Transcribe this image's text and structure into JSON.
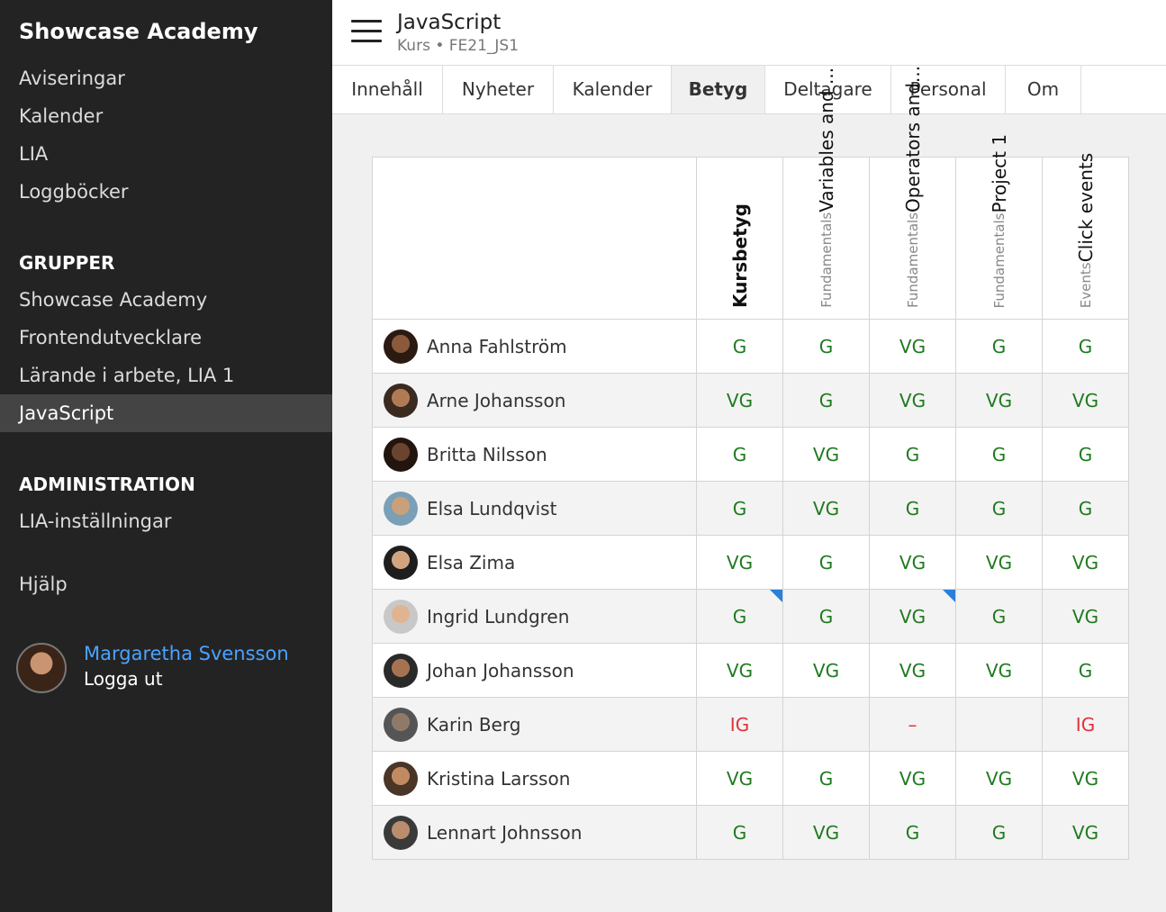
{
  "sidebar": {
    "brand": "Showcase Academy",
    "top_items": [
      "Aviseringar",
      "Kalender",
      "LIA",
      "Loggböcker"
    ],
    "groups_heading": "GRUPPER",
    "groups": [
      "Showcase Academy",
      "Frontendutvecklare",
      "Lärande i arbete, LIA 1",
      "JavaScript"
    ],
    "active_group": "JavaScript",
    "admin_heading": "ADMINISTRATION",
    "admin_items": [
      "LIA-inställningar"
    ],
    "help": "Hjälp",
    "user_name": "Margaretha Svensson",
    "logout": "Logga ut"
  },
  "header": {
    "title": "JavaScript",
    "subtitle": "Kurs • FE21_JS1"
  },
  "tabs": [
    "Innehåll",
    "Nyheter",
    "Kalender",
    "Betyg",
    "Deltagare",
    "Personal",
    "Om"
  ],
  "active_tab": "Betyg",
  "grades": {
    "columns": [
      {
        "category": "",
        "name": "Kursbetyg"
      },
      {
        "category": "Fundamentals",
        "name": "Variables and ..."
      },
      {
        "category": "Fundamentals",
        "name": "Operators and..."
      },
      {
        "category": "Fundamentals",
        "name": "Project 1"
      },
      {
        "category": "Events",
        "name": "Click events"
      }
    ],
    "students": [
      {
        "name": "Anna Fahlström",
        "grades": [
          "G",
          "G",
          "VG",
          "G",
          "G"
        ]
      },
      {
        "name": "Arne Johansson",
        "grades": [
          "VG",
          "G",
          "VG",
          "VG",
          "VG"
        ]
      },
      {
        "name": "Britta Nilsson",
        "grades": [
          "G",
          "VG",
          "G",
          "G",
          "G"
        ]
      },
      {
        "name": "Elsa Lundqvist",
        "grades": [
          "G",
          "VG",
          "G",
          "G",
          "G"
        ]
      },
      {
        "name": "Elsa Zima",
        "grades": [
          "VG",
          "G",
          "VG",
          "VG",
          "VG"
        ]
      },
      {
        "name": "Ingrid Lundgren",
        "grades": [
          "G",
          "G",
          "VG",
          "G",
          "VG"
        ]
      },
      {
        "name": "Johan Johansson",
        "grades": [
          "VG",
          "VG",
          "VG",
          "VG",
          "G"
        ]
      },
      {
        "name": "Karin Berg",
        "grades": [
          "IG",
          "",
          "–",
          "",
          "IG"
        ]
      },
      {
        "name": "Kristina Larsson",
        "grades": [
          "VG",
          "G",
          "VG",
          "VG",
          "VG"
        ]
      },
      {
        "name": "Lennart Johnsson",
        "grades": [
          "G",
          "VG",
          "G",
          "G",
          "VG"
        ]
      }
    ]
  },
  "colors": {
    "passing": "#1f7a1f",
    "failing": "#e0313a",
    "flag": "#2a7fdb",
    "link": "#4aa3ff"
  }
}
